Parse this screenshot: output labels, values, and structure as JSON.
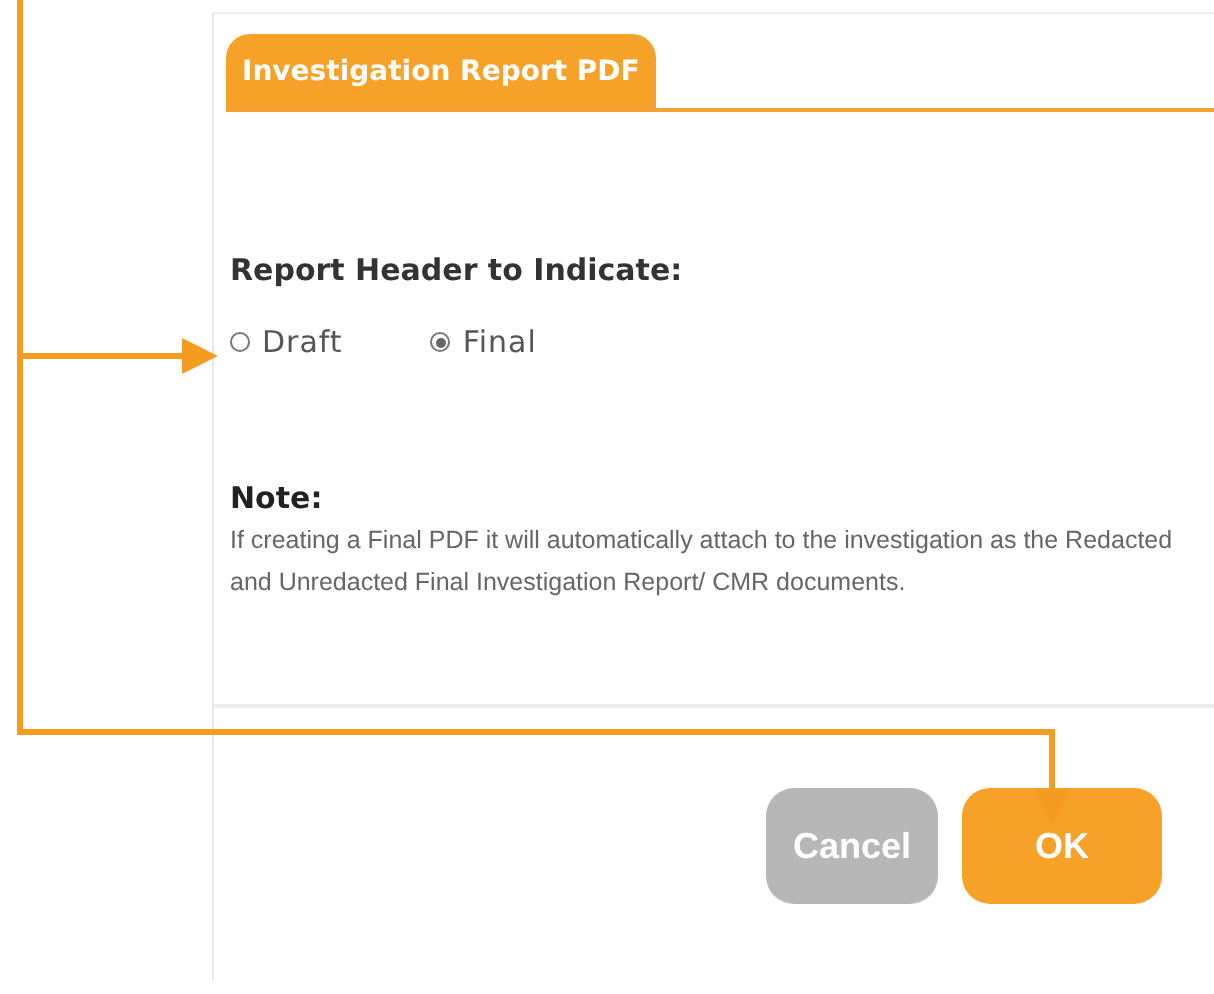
{
  "tab": {
    "label": "Investigation Report PDF",
    "selected": true
  },
  "field": {
    "label": "Report Header to Indicate:",
    "options": [
      {
        "label": "Draft",
        "selected": false
      },
      {
        "label": "Final",
        "selected": true
      }
    ]
  },
  "note": {
    "title": "Note:",
    "text": "If creating a Final PDF it will automatically attach to the investigation as the Redacted and Unredacted Final Investigation Report/ CMR documents."
  },
  "buttons": [
    {
      "label": "Cancel",
      "kind": "secondary"
    },
    {
      "label": "OK",
      "kind": "primary"
    }
  ]
}
